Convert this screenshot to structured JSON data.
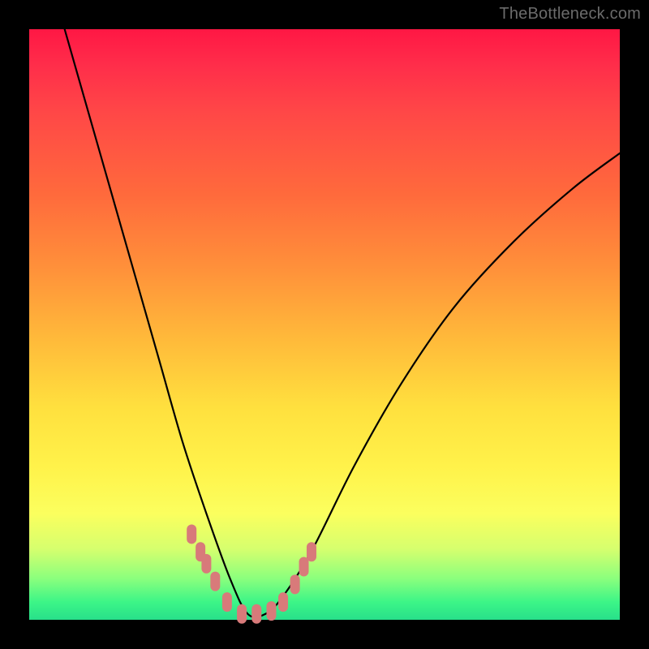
{
  "watermark": "TheBottleneck.com",
  "colors": {
    "frame": "#000000",
    "watermark": "#6b6b6b",
    "curve": "#000000",
    "marker_fill": "#d87a7a",
    "gradient_stops": [
      "#ff1744",
      "#ff2d4a",
      "#ff4747",
      "#ff6a3c",
      "#ff8f3a",
      "#ffb83a",
      "#ffe03e",
      "#fff24a",
      "#fbff5e",
      "#d6ff6e",
      "#8bff7d",
      "#3cf587",
      "#28e08a"
    ]
  },
  "chart_data": {
    "type": "line",
    "title": "",
    "xlabel": "",
    "ylabel": "",
    "x_range": [
      0,
      1
    ],
    "y_range": [
      0,
      1
    ],
    "note": "Axes are unitless/unlabeled. x is normalized horizontal position; y is normalized value (0 = bottom/green, 1 = top/red). Curve is a V-shape with minimum near x≈0.37.",
    "series": [
      {
        "name": "bottleneck-curve",
        "x": [
          0.06,
          0.1,
          0.14,
          0.18,
          0.22,
          0.26,
          0.3,
          0.34,
          0.37,
          0.4,
          0.43,
          0.48,
          0.55,
          0.63,
          0.72,
          0.82,
          0.92,
          1.0
        ],
        "y": [
          1.0,
          0.86,
          0.72,
          0.58,
          0.44,
          0.3,
          0.18,
          0.07,
          0.01,
          0.01,
          0.04,
          0.12,
          0.26,
          0.4,
          0.53,
          0.64,
          0.73,
          0.79
        ]
      }
    ],
    "markers": {
      "name": "highlighted-points",
      "note": "Salmon-colored segment markers near the valley of the curve.",
      "x": [
        0.275,
        0.29,
        0.3,
        0.315,
        0.335,
        0.36,
        0.385,
        0.41,
        0.43,
        0.45,
        0.465,
        0.478
      ],
      "y": [
        0.145,
        0.115,
        0.095,
        0.065,
        0.03,
        0.01,
        0.01,
        0.015,
        0.03,
        0.06,
        0.09,
        0.115
      ]
    }
  }
}
